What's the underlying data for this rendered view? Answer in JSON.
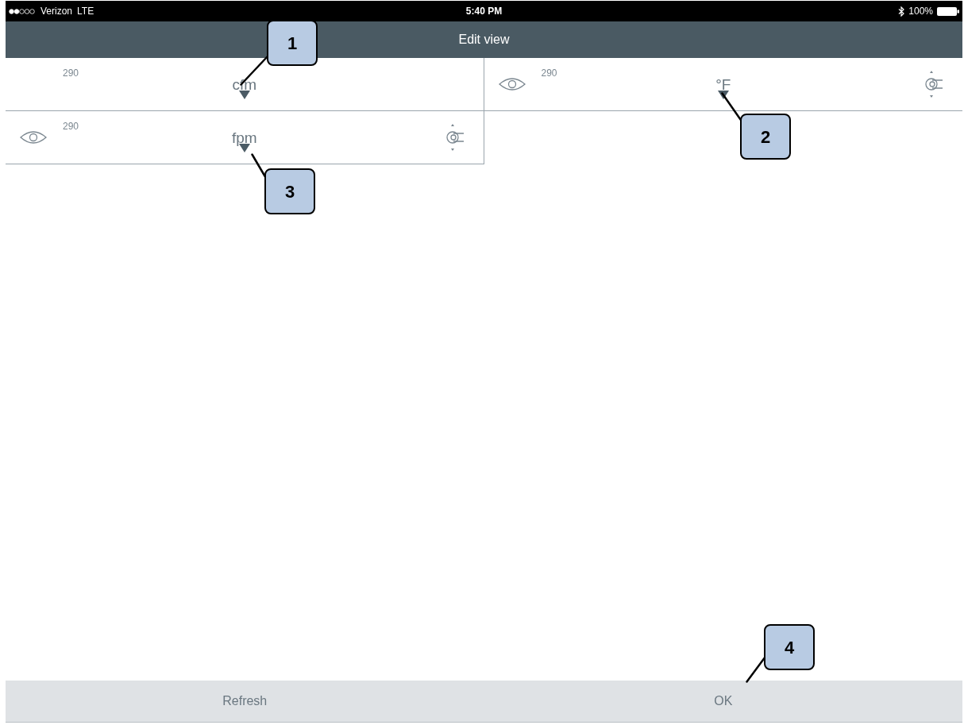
{
  "status_bar": {
    "carrier": "Verizon",
    "network": "LTE",
    "time": "5:40 PM",
    "battery": "100%"
  },
  "header": {
    "title": "Edit view"
  },
  "tiles": [
    {
      "value": "290",
      "unit": "cfm",
      "controls_visible": false
    },
    {
      "value": "290",
      "unit": "°F",
      "controls_visible": true
    },
    {
      "value": "290",
      "unit": "fpm",
      "controls_visible": true
    }
  ],
  "bottom_bar": {
    "buttons": [
      "Refresh",
      "OK"
    ]
  },
  "callouts": [
    {
      "label": "1"
    },
    {
      "label": "2"
    },
    {
      "label": "3"
    },
    {
      "label": "4"
    }
  ]
}
